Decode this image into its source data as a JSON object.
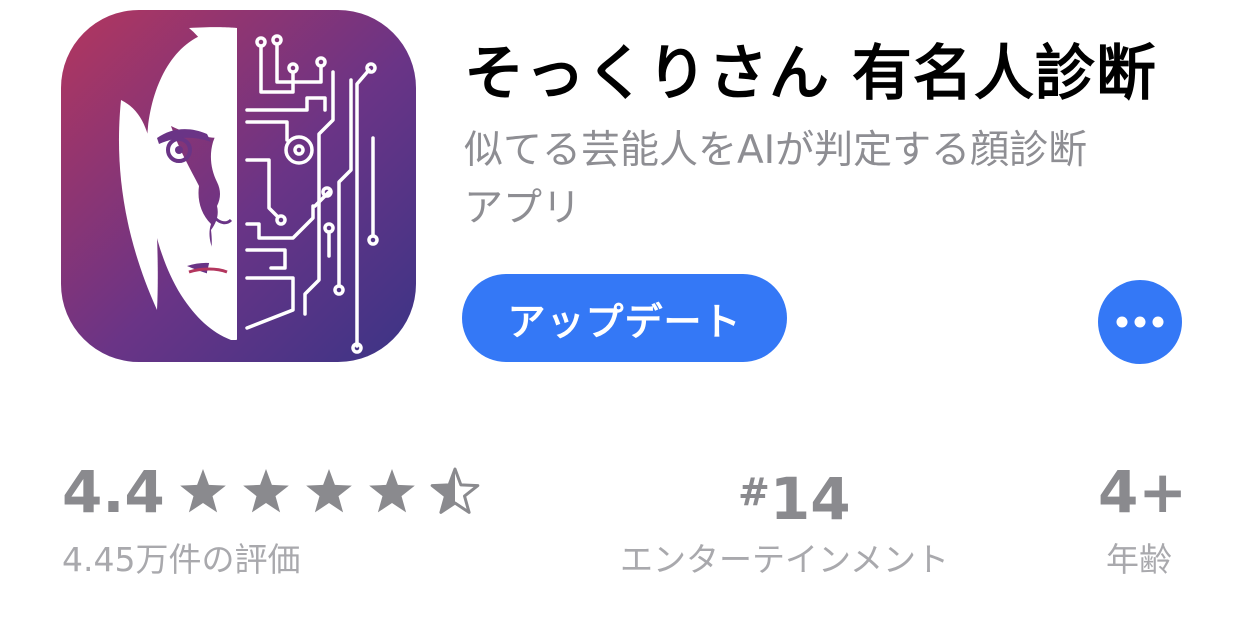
{
  "app": {
    "title": "そっくりさん 有名人診断",
    "subtitle_line1": "似てる芸能人をAIが判定する顔診断",
    "subtitle_line2": "アプリ",
    "icon_name": "face-circuit-app-icon"
  },
  "actions": {
    "update_label": "アップデート",
    "more_icon": "ellipsis-icon"
  },
  "ratings": {
    "score": "4.4",
    "stars_value": 4.4,
    "stars_max": 5,
    "count_label": "4.45万件の評価"
  },
  "chart": {
    "hash": "#",
    "rank": "14",
    "category": "エンターテインメント"
  },
  "age": {
    "value": "4+",
    "label": "年齢"
  },
  "colors": {
    "accent": "#3478f6",
    "icon_gradient_start": "#b3365e",
    "icon_gradient_end": "#3b3486",
    "secondary_text": "#8e8e93"
  }
}
